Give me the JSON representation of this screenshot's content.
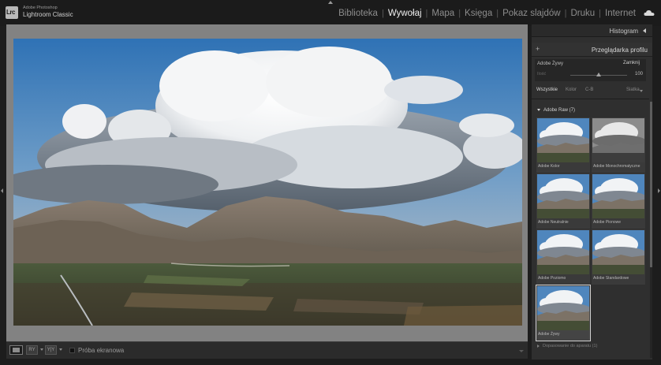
{
  "app": {
    "logo_text": "Lrc",
    "brand_top": "Adobe Photoshop",
    "brand_main": "Lightroom Classic"
  },
  "modules": [
    {
      "label": "Biblioteka",
      "active": false
    },
    {
      "label": "Wywołaj",
      "active": true
    },
    {
      "label": "Mapa",
      "active": false
    },
    {
      "label": "Księga",
      "active": false
    },
    {
      "label": "Pokaz slajdów",
      "active": false
    },
    {
      "label": "Druku",
      "active": false
    },
    {
      "label": "Internet",
      "active": false
    }
  ],
  "module_separator": "|",
  "toolbar": {
    "soft_proof_label": "Próba ekranowa",
    "ry_label": "RY",
    "yy_label": "Y|Y"
  },
  "panel": {
    "histogram_label": "Histogram",
    "browser_label": "Przeglądarka profilu",
    "browser_plus": "+",
    "profile_name": "Adobe Żywy",
    "close_label": "Zamknij",
    "amount_label": "Ilość",
    "amount_value": "100",
    "amount_fraction": 0.5,
    "filters": {
      "all": "Wszystkie",
      "color": "Kolor",
      "bw": "C-B",
      "grid": "Siatka"
    },
    "group_label": "Adobe Raw (7)",
    "profiles": [
      {
        "label": "Adobe Kolor",
        "mono": false,
        "selected": false
      },
      {
        "label": "Adobe Monochromatyczne",
        "mono": true,
        "selected": false
      },
      {
        "label": "Adobe Neutralnie",
        "mono": false,
        "selected": false
      },
      {
        "label": "Adobe Pionowe",
        "mono": false,
        "selected": false
      },
      {
        "label": "Adobe Poziomo",
        "mono": false,
        "selected": false
      },
      {
        "label": "Adobe Standardowe",
        "mono": false,
        "selected": false
      },
      {
        "label": "Adobe Żywy",
        "mono": false,
        "selected": true
      }
    ],
    "footer_group_label": "Dopasowanie do aparatu (1)"
  },
  "colors": {
    "accent": "#efefef",
    "background": "#1d1d1d",
    "canvas": "#828282",
    "panel": "#2f2f2f"
  }
}
